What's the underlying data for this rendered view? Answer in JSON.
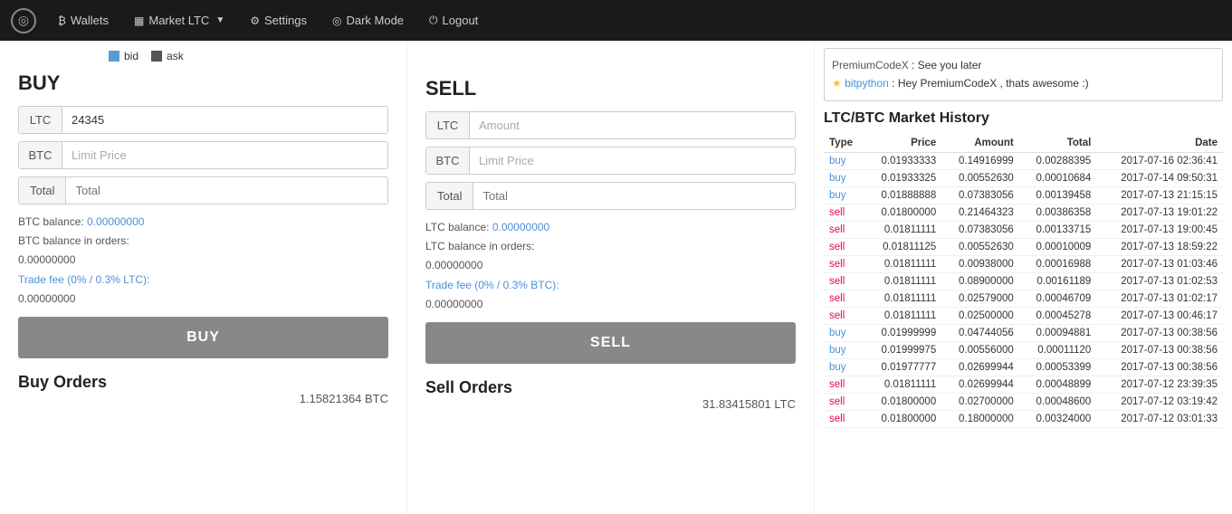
{
  "navbar": {
    "brand_icon": "◎",
    "items": [
      {
        "id": "wallets",
        "icon": "₿",
        "label": "Wallets"
      },
      {
        "id": "market",
        "icon": "▦",
        "label": "Market LTC",
        "dropdown": true
      },
      {
        "id": "settings",
        "icon": "⚙",
        "label": "Settings"
      },
      {
        "id": "darkmode",
        "icon": "◎",
        "label": "Dark Mode"
      },
      {
        "id": "logout",
        "icon": "⏻",
        "label": "Logout"
      }
    ]
  },
  "chart_legend": {
    "bid": {
      "label": "bid",
      "color": "#5b9bd5"
    },
    "ask": {
      "label": "ask",
      "color": "#555"
    }
  },
  "buy": {
    "title": "BUY",
    "ltc_prefix": "LTC",
    "ltc_value": "24345",
    "btc_prefix": "BTC",
    "btc_placeholder": "Limit Price",
    "total_label": "Total",
    "total_placeholder": "Total",
    "btc_balance_label": "BTC balance:",
    "btc_balance_value": "0.00000000",
    "btc_balance_orders_label": "BTC balance in orders:",
    "btc_balance_orders_value": "0.00000000",
    "trade_fee_label": "Trade fee (0% / 0.3% LTC):",
    "trade_fee_value": "0.00000000",
    "button_label": "BUY"
  },
  "sell": {
    "title": "SELL",
    "ltc_prefix": "LTC",
    "ltc_placeholder": "Amount",
    "btc_prefix": "BTC",
    "btc_placeholder": "Limit Price",
    "total_label": "Total",
    "total_placeholder": "Total",
    "ltc_balance_label": "LTC balance:",
    "ltc_balance_value": "0.00000000",
    "ltc_balance_orders_label": "LTC balance in orders:",
    "ltc_balance_orders_value": "0.00000000",
    "trade_fee_label": "Trade fee (0% / 0.3% BTC):",
    "trade_fee_value": "0.00000000",
    "button_label": "SELL"
  },
  "buy_orders": {
    "title": "Buy Orders",
    "total": "1.15821364 BTC"
  },
  "sell_orders": {
    "title": "Sell Orders",
    "total": "31.83415801 LTC"
  },
  "chat": {
    "messages": [
      {
        "user": "PremiumCodeX",
        "text": ": See you later"
      },
      {
        "user": "bitpython",
        "text": ": Hey PremiumCodeX , thats awesome :)",
        "is_link": true
      }
    ]
  },
  "market_history": {
    "title": "LTC/BTC Market History",
    "columns": [
      "Type",
      "Price",
      "Amount",
      "Total",
      "Date"
    ],
    "rows": [
      {
        "type": "buy",
        "price": "0.01933333",
        "amount": "0.14916999",
        "total": "0.00288395",
        "date": "2017-07-16 02:36:41"
      },
      {
        "type": "buy",
        "price": "0.01933325",
        "amount": "0.00552630",
        "total": "0.00010684",
        "date": "2017-07-14 09:50:31"
      },
      {
        "type": "buy",
        "price": "0.01888888",
        "amount": "0.07383056",
        "total": "0.00139458",
        "date": "2017-07-13 21:15:15"
      },
      {
        "type": "sell",
        "price": "0.01800000",
        "amount": "0.21464323",
        "total": "0.00386358",
        "date": "2017-07-13 19:01:22"
      },
      {
        "type": "sell",
        "price": "0.01811111",
        "amount": "0.07383056",
        "total": "0.00133715",
        "date": "2017-07-13 19:00:45"
      },
      {
        "type": "sell",
        "price": "0.01811125",
        "amount": "0.00552630",
        "total": "0.00010009",
        "date": "2017-07-13 18:59:22"
      },
      {
        "type": "sell",
        "price": "0.01811111",
        "amount": "0.00938000",
        "total": "0.00016988",
        "date": "2017-07-13 01:03:46"
      },
      {
        "type": "sell",
        "price": "0.01811111",
        "amount": "0.08900000",
        "total": "0.00161189",
        "date": "2017-07-13 01:02:53"
      },
      {
        "type": "sell",
        "price": "0.01811111",
        "amount": "0.02579000",
        "total": "0.00046709",
        "date": "2017-07-13 01:02:17"
      },
      {
        "type": "sell",
        "price": "0.01811111",
        "amount": "0.02500000",
        "total": "0.00045278",
        "date": "2017-07-13 00:46:17"
      },
      {
        "type": "buy",
        "price": "0.01999999",
        "amount": "0.04744056",
        "total": "0.00094881",
        "date": "2017-07-13 00:38:56"
      },
      {
        "type": "buy",
        "price": "0.01999975",
        "amount": "0.00556000",
        "total": "0.00011120",
        "date": "2017-07-13 00:38:56"
      },
      {
        "type": "buy",
        "price": "0.01977777",
        "amount": "0.02699944",
        "total": "0.00053399",
        "date": "2017-07-13 00:38:56"
      },
      {
        "type": "sell",
        "price": "0.01811111",
        "amount": "0.02699944",
        "total": "0.00048899",
        "date": "2017-07-12 23:39:35"
      },
      {
        "type": "sell",
        "price": "0.01800000",
        "amount": "0.02700000",
        "total": "0.00048600",
        "date": "2017-07-12 03:19:42"
      },
      {
        "type": "sell",
        "price": "0.01800000",
        "amount": "0.18000000",
        "total": "0.00324000",
        "date": "2017-07-12 03:01:33"
      }
    ]
  }
}
